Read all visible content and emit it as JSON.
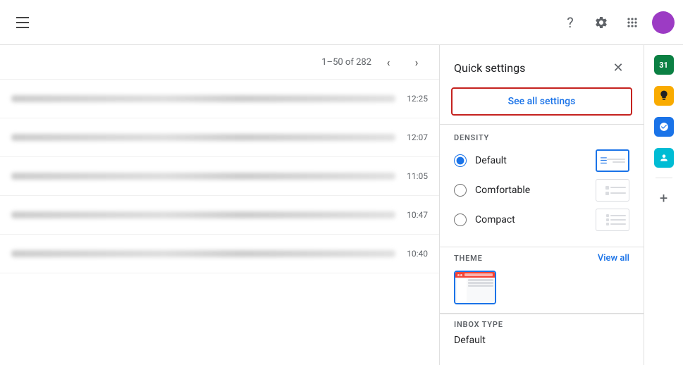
{
  "topbar": {
    "pagination_text": "1–50 of 282",
    "help_icon": "?",
    "settings_icon": "⚙",
    "apps_icon": "⠿"
  },
  "emails": [
    {
      "time": "12:25"
    },
    {
      "time": "12:07"
    },
    {
      "time": "11:05"
    },
    {
      "time": "10:47"
    },
    {
      "time": "10:40"
    }
  ],
  "quick_settings": {
    "title": "Quick settings",
    "see_all_label": "See all settings",
    "density": {
      "section_label": "DENSITY",
      "options": [
        {
          "id": "default",
          "label": "Default",
          "selected": true
        },
        {
          "id": "comfortable",
          "label": "Comfortable",
          "selected": false
        },
        {
          "id": "compact",
          "label": "Compact",
          "selected": false
        }
      ]
    },
    "theme": {
      "section_label": "THEME",
      "view_all_label": "View all"
    },
    "inbox_type": {
      "section_label": "INBOX TYPE",
      "current_value": "Default"
    }
  },
  "right_sidebar": {
    "icons": [
      {
        "name": "calendar",
        "color": "green"
      },
      {
        "name": "keep",
        "color": "yellow"
      },
      {
        "name": "tasks",
        "color": "blue"
      },
      {
        "name": "contacts",
        "color": "teal"
      }
    ],
    "add_label": "+"
  }
}
